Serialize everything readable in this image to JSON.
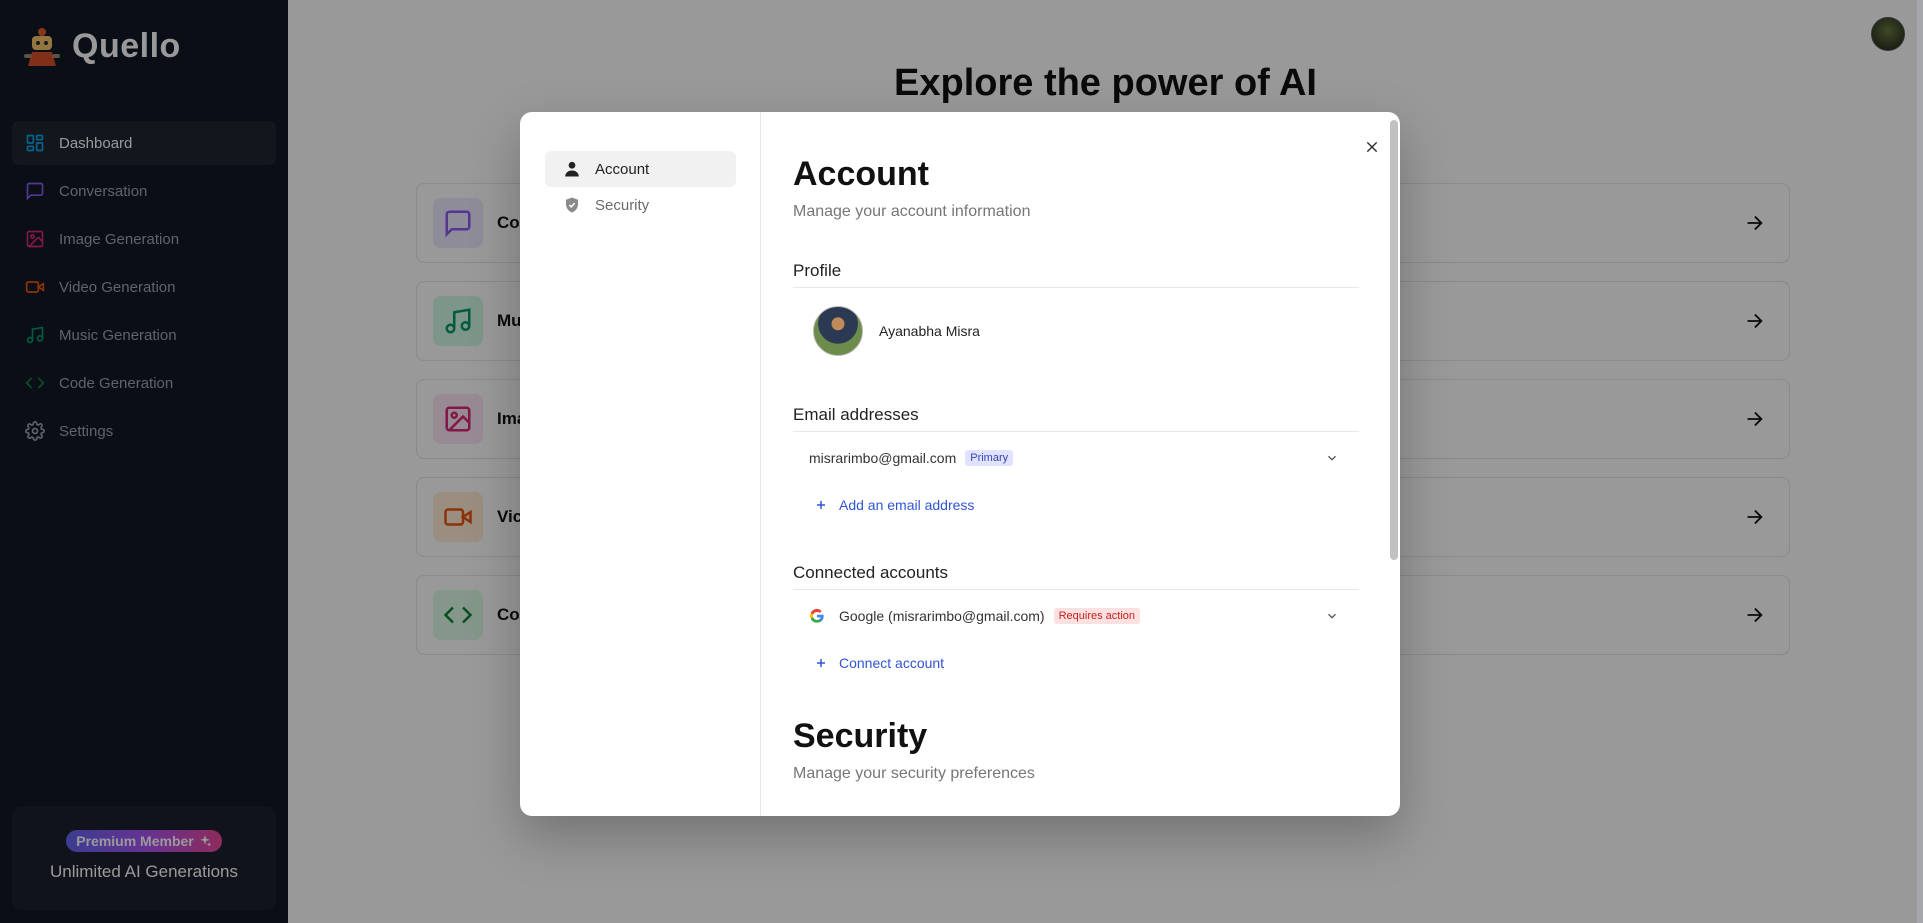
{
  "sidebar": {
    "brand": "Quello",
    "nav": [
      {
        "label": "Dashboard",
        "icon": "dashboard-icon",
        "color": "#0ea5e9"
      },
      {
        "label": "Conversation",
        "icon": "message-icon",
        "color": "#8b5cf6"
      },
      {
        "label": "Image Generation",
        "icon": "image-icon",
        "color": "#db2777"
      },
      {
        "label": "Video Generation",
        "icon": "video-icon",
        "color": "#ea580c"
      },
      {
        "label": "Music Generation",
        "icon": "music-icon",
        "color": "#059669"
      },
      {
        "label": "Code Generation",
        "icon": "code-icon",
        "color": "#15803d"
      },
      {
        "label": "Settings",
        "icon": "gear-icon",
        "color": "#9ca3af"
      }
    ],
    "promo": {
      "badge": "Premium Member",
      "text": "Unlimited AI Generations"
    }
  },
  "main": {
    "title": "Explore the power of AI",
    "tools": [
      {
        "label": "Co",
        "icon": "message-icon",
        "color": "#8b5cf6",
        "bg": "#ede9fe"
      },
      {
        "label": "Mu",
        "icon": "music-icon",
        "color": "#059669",
        "bg": "#d1fae5"
      },
      {
        "label": "Ima",
        "icon": "image-icon",
        "color": "#db2777",
        "bg": "#fce7f3"
      },
      {
        "label": "Vic",
        "icon": "video-icon",
        "color": "#ea580c",
        "bg": "#ffedd5"
      },
      {
        "label": "Co",
        "icon": "code-icon",
        "color": "#15803d",
        "bg": "#dcfce7"
      }
    ]
  },
  "modal": {
    "nav": [
      {
        "label": "Account",
        "icon": "user-icon"
      },
      {
        "label": "Security",
        "icon": "shield-icon"
      }
    ],
    "account": {
      "title": "Account",
      "subtitle": "Manage your account information",
      "profile_title": "Profile",
      "profile_name": "Ayanabha Misra",
      "email_title": "Email addresses",
      "email": "misrarimbo@gmail.com",
      "email_badge": "Primary",
      "add_email": "Add an email address",
      "connected_title": "Connected accounts",
      "connected_account": "Google (misrarimbo@gmail.com)",
      "connected_badge": "Requires action",
      "connect_account": "Connect account"
    },
    "security": {
      "title": "Security",
      "subtitle": "Manage your security preferences"
    }
  }
}
